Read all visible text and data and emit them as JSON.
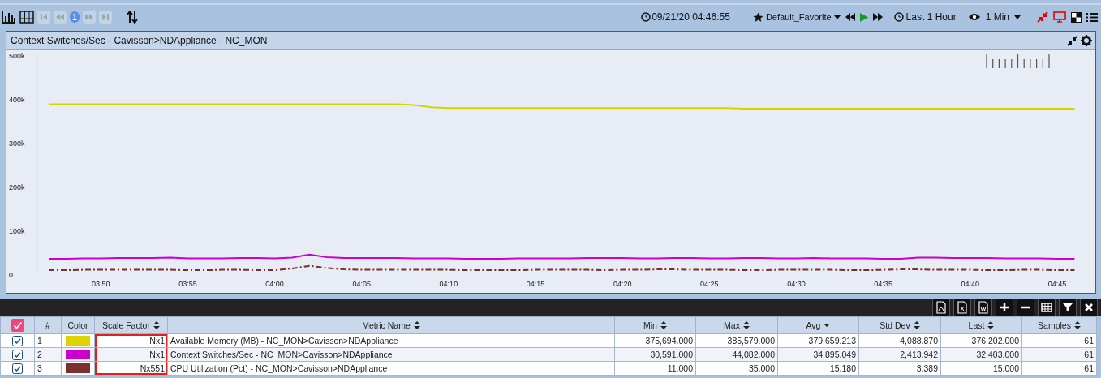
{
  "toolbar": {
    "page": "1",
    "timestamp": "09/21/20 04:46:55",
    "favorite": "Default_Favorite",
    "range": "Last 1 Hour",
    "interval": "1 Min"
  },
  "panel": {
    "title": "Context Switches/Sec - Cavisson>NDAppliance - NC_MON",
    "chart_data": {
      "type": "line",
      "ylim": [
        0,
        500000
      ],
      "categories": [
        null,
        null,
        null,
        "03:50",
        null,
        null,
        null,
        null,
        "03:55",
        null,
        null,
        null,
        null,
        "04:00",
        null,
        null,
        null,
        null,
        "04:05",
        null,
        null,
        null,
        null,
        "04:10",
        null,
        null,
        null,
        null,
        "04:15",
        null,
        null,
        null,
        null,
        "04:20",
        null,
        null,
        null,
        null,
        "04:25",
        null,
        null,
        null,
        null,
        "04:30",
        null,
        null,
        null,
        null,
        "04:35",
        null,
        null,
        null,
        null,
        "04:40",
        null,
        null,
        null,
        null,
        "04:45",
        null
      ],
      "yticks": [
        {
          "value": 0,
          "label": "0"
        },
        {
          "value": 100000,
          "label": "100k"
        },
        {
          "value": 200000,
          "label": "200k"
        },
        {
          "value": 300000,
          "label": "300k"
        },
        {
          "value": 400000,
          "label": "400k"
        },
        {
          "value": 500000,
          "label": "500k"
        }
      ],
      "series": [
        {
          "color": "#d4d400",
          "line_style": "solid",
          "values": [
            388000,
            388000,
            388000,
            388000,
            388000,
            388000,
            388000,
            388000,
            388000,
            388000,
            388000,
            388000,
            388000,
            388000,
            388000,
            388000,
            388000,
            388000,
            388000,
            388000,
            388000,
            386000,
            381000,
            379000,
            379000,
            379000,
            379000,
            379000,
            379000,
            379000,
            379000,
            379000,
            379000,
            379000,
            379000,
            379000,
            379000,
            379000,
            379000,
            379000,
            378000,
            378000,
            378000,
            378000,
            378000,
            378000,
            378000,
            378000,
            378000,
            378000,
            378000,
            378000,
            378000,
            378000,
            378000,
            378000,
            378000,
            378000,
            378000,
            378000
          ]
        },
        {
          "color": "#cc00cc",
          "line_style": "solid",
          "values": [
            35000,
            35000,
            36000,
            36000,
            37000,
            37000,
            37000,
            38000,
            36000,
            36000,
            36000,
            37000,
            37000,
            36000,
            38000,
            45000,
            39000,
            37000,
            37000,
            37000,
            37000,
            36000,
            36000,
            36000,
            35000,
            35000,
            35000,
            36000,
            36000,
            36000,
            36000,
            37000,
            37000,
            37000,
            36000,
            36000,
            37000,
            37000,
            36000,
            36000,
            37000,
            37000,
            36000,
            36000,
            37000,
            36000,
            36000,
            36000,
            35000,
            35000,
            38000,
            38000,
            37000,
            37000,
            37000,
            36000,
            36000,
            36000,
            35000,
            35000
          ]
        },
        {
          "color": "#7b2c2c",
          "line_style": "dashdot",
          "values": [
            9000,
            9000,
            10000,
            10000,
            10000,
            10000,
            10000,
            10000,
            9000,
            9000,
            10000,
            10000,
            9000,
            9000,
            13000,
            19000,
            14000,
            11000,
            10000,
            10000,
            10000,
            10000,
            10000,
            10000,
            9000,
            9000,
            9000,
            9000,
            10000,
            10000,
            10000,
            10000,
            9000,
            10000,
            10000,
            11000,
            11000,
            10000,
            10000,
            10000,
            9000,
            9000,
            10000,
            10000,
            10000,
            10000,
            9000,
            9000,
            10000,
            11000,
            11000,
            10000,
            10000,
            10000,
            9000,
            9000,
            10000,
            10000,
            9000,
            9000
          ]
        }
      ]
    }
  },
  "table": {
    "all_checked": true,
    "columns": [
      {
        "label": "#",
        "sortable": false,
        "sort_descending": false
      },
      {
        "label": "Color",
        "sortable": false,
        "sort_descending": false
      },
      {
        "label": "Scale Factor",
        "sortable": true,
        "sort_descending": false
      },
      {
        "label": "Metric Name",
        "sortable": true,
        "sort_descending": false
      },
      {
        "label": "Min",
        "sortable": true,
        "sort_descending": false
      },
      {
        "label": "Max",
        "sortable": true,
        "sort_descending": false
      },
      {
        "label": "Avg",
        "sortable": true,
        "sort_descending": true
      },
      {
        "label": "Std Dev",
        "sortable": true,
        "sort_descending": false
      },
      {
        "label": "Last",
        "sortable": true,
        "sort_descending": false
      },
      {
        "label": "Samples",
        "sortable": true,
        "sort_descending": false
      }
    ],
    "rows": [
      {
        "checked": true,
        "index": "1",
        "color": "#dcd400",
        "scale": "Nx1",
        "scale_highlighted": true,
        "metric": "Available Memory (MB) - NC_MON>Cavisson>NDAppliance",
        "min": "375,694.000",
        "max": "385,579.000",
        "avg": "379,659.213",
        "std_dev": "4,088.870",
        "last": "376,202.000",
        "samples": "61"
      },
      {
        "checked": true,
        "index": "2",
        "color": "#cc00cc",
        "scale": "Nx1",
        "scale_highlighted": true,
        "metric": "Context Switches/Sec - NC_MON>Cavisson>NDAppliance",
        "min": "30,591.000",
        "max": "44,082.000",
        "avg": "34,895.049",
        "std_dev": "2,413.942",
        "last": "32,403.000",
        "samples": "61"
      },
      {
        "checked": true,
        "index": "3",
        "color": "#7b3030",
        "scale": "Nx551",
        "scale_highlighted": true,
        "metric": "CPU Utilization (Pct) - NC_MON>Cavisson>NDAppliance",
        "min": "11.000",
        "max": "35.000",
        "avg": "15.180",
        "std_dev": "3.389",
        "last": "15.000",
        "samples": "61"
      }
    ]
  }
}
